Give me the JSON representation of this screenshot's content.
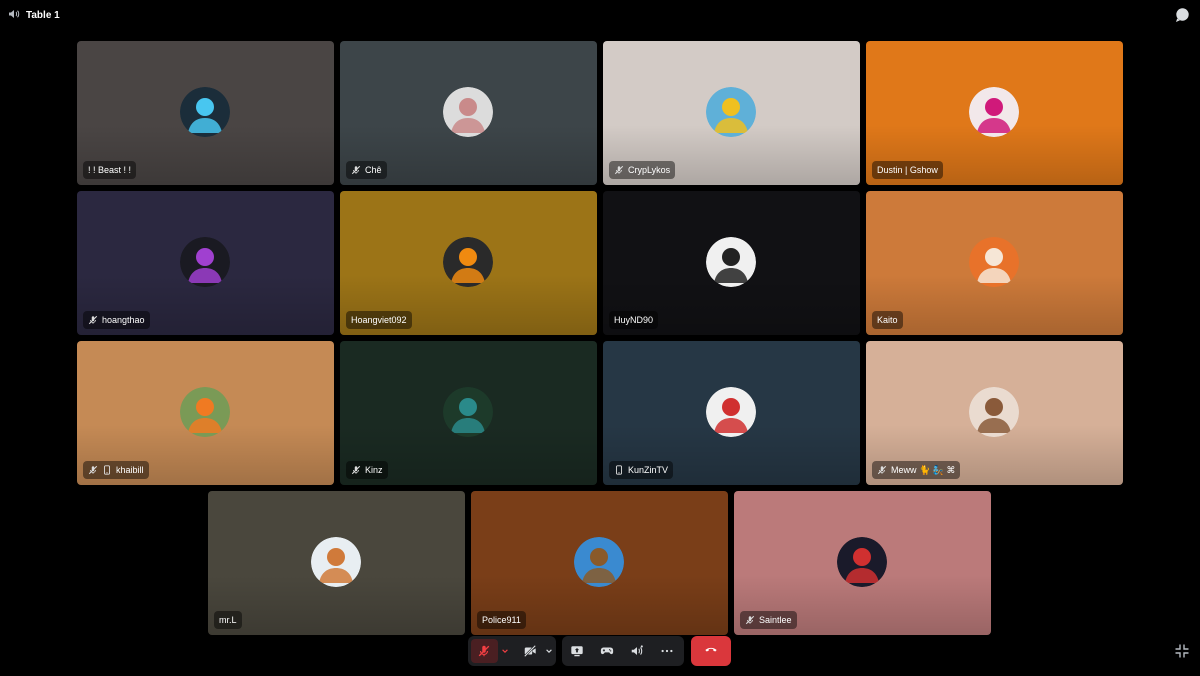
{
  "channel": {
    "name": "Table 1",
    "icon": "speaker-icon"
  },
  "topbar": {
    "chat_icon": "chat-bubble-icon"
  },
  "participants": [
    {
      "name": "! ! Beast ! !",
      "bg": "#4a4544",
      "avatar_bg": "#1b2d3a",
      "avatar_fg": "#48c6f0",
      "muted": false,
      "mobile": false
    },
    {
      "name": "Chê",
      "bg": "#3d4549",
      "avatar_bg": "#dcdcdc",
      "avatar_fg": "#c98a8a",
      "muted": true,
      "mobile": false
    },
    {
      "name": "CrypLykos",
      "bg": "#d3cbc6",
      "avatar_bg": "#5fb0d8",
      "avatar_fg": "#f0c020",
      "muted": true,
      "mobile": false
    },
    {
      "name": "Dustin | Gshow",
      "bg": "#e07819",
      "avatar_bg": "#f2e8ea",
      "avatar_fg": "#d0197a",
      "muted": false,
      "mobile": false
    },
    {
      "name": "hoangthao",
      "bg": "#2b2840",
      "avatar_bg": "#1a1a22",
      "avatar_fg": "#a040d0",
      "muted": true,
      "mobile": false
    },
    {
      "name": "Hoangviet092",
      "bg": "#9c7417",
      "avatar_bg": "#2a2a2a",
      "avatar_fg": "#f08a10",
      "muted": false,
      "mobile": false
    },
    {
      "name": "HuyND90",
      "bg": "#111114",
      "avatar_bg": "#f0f0f0",
      "avatar_fg": "#222222",
      "muted": false,
      "mobile": false
    },
    {
      "name": "Kaito",
      "bg": "#cd7a3a",
      "avatar_bg": "#e8722a",
      "avatar_fg": "#f6e6d6",
      "muted": false,
      "mobile": false
    },
    {
      "name": "khaibill",
      "bg": "#c58a55",
      "avatar_bg": "#7a9a56",
      "avatar_fg": "#f07a22",
      "muted": true,
      "mobile": true
    },
    {
      "name": "Kinz",
      "bg": "#1a2a22",
      "avatar_bg": "#1d3a2a",
      "avatar_fg": "#2a8a8a",
      "muted": true,
      "mobile": false
    },
    {
      "name": "KunZinTV",
      "bg": "#263745",
      "avatar_bg": "#f0f0f0",
      "avatar_fg": "#d03030",
      "muted": false,
      "mobile": true
    },
    {
      "name": "Meww 🐈 🧞 ⌘",
      "bg": "#d6b098",
      "avatar_bg": "#eadbd0",
      "avatar_fg": "#8a5a3a",
      "muted": true,
      "mobile": false
    },
    {
      "name": "mr.L",
      "bg": "#4a473d",
      "avatar_bg": "#e8eef2",
      "avatar_fg": "#d07a3a",
      "muted": false,
      "mobile": false
    },
    {
      "name": "Police911",
      "bg": "#7a3e18",
      "avatar_bg": "#3a8ad0",
      "avatar_fg": "#8a5a2a",
      "muted": false,
      "mobile": false
    },
    {
      "name": "Saintlee",
      "bg": "#bb7a7a",
      "avatar_bg": "#1a1a2a",
      "avatar_fg": "#d03030",
      "muted": true,
      "mobile": false
    }
  ],
  "controls": {
    "mic_icon": "microphone-muted-icon",
    "mic_options_icon": "chevron-down-icon",
    "camera_icon": "camera-off-icon",
    "camera_options_icon": "chevron-down-icon",
    "screen_share_icon": "screen-share-icon",
    "activity_icon": "gamepad-icon",
    "soundboard_icon": "soundboard-icon",
    "more_icon": "more-options-icon",
    "end_call_icon": "end-call-icon",
    "end_call_color": "#da373c",
    "exit_fullscreen_icon": "exit-fullscreen-icon"
  }
}
